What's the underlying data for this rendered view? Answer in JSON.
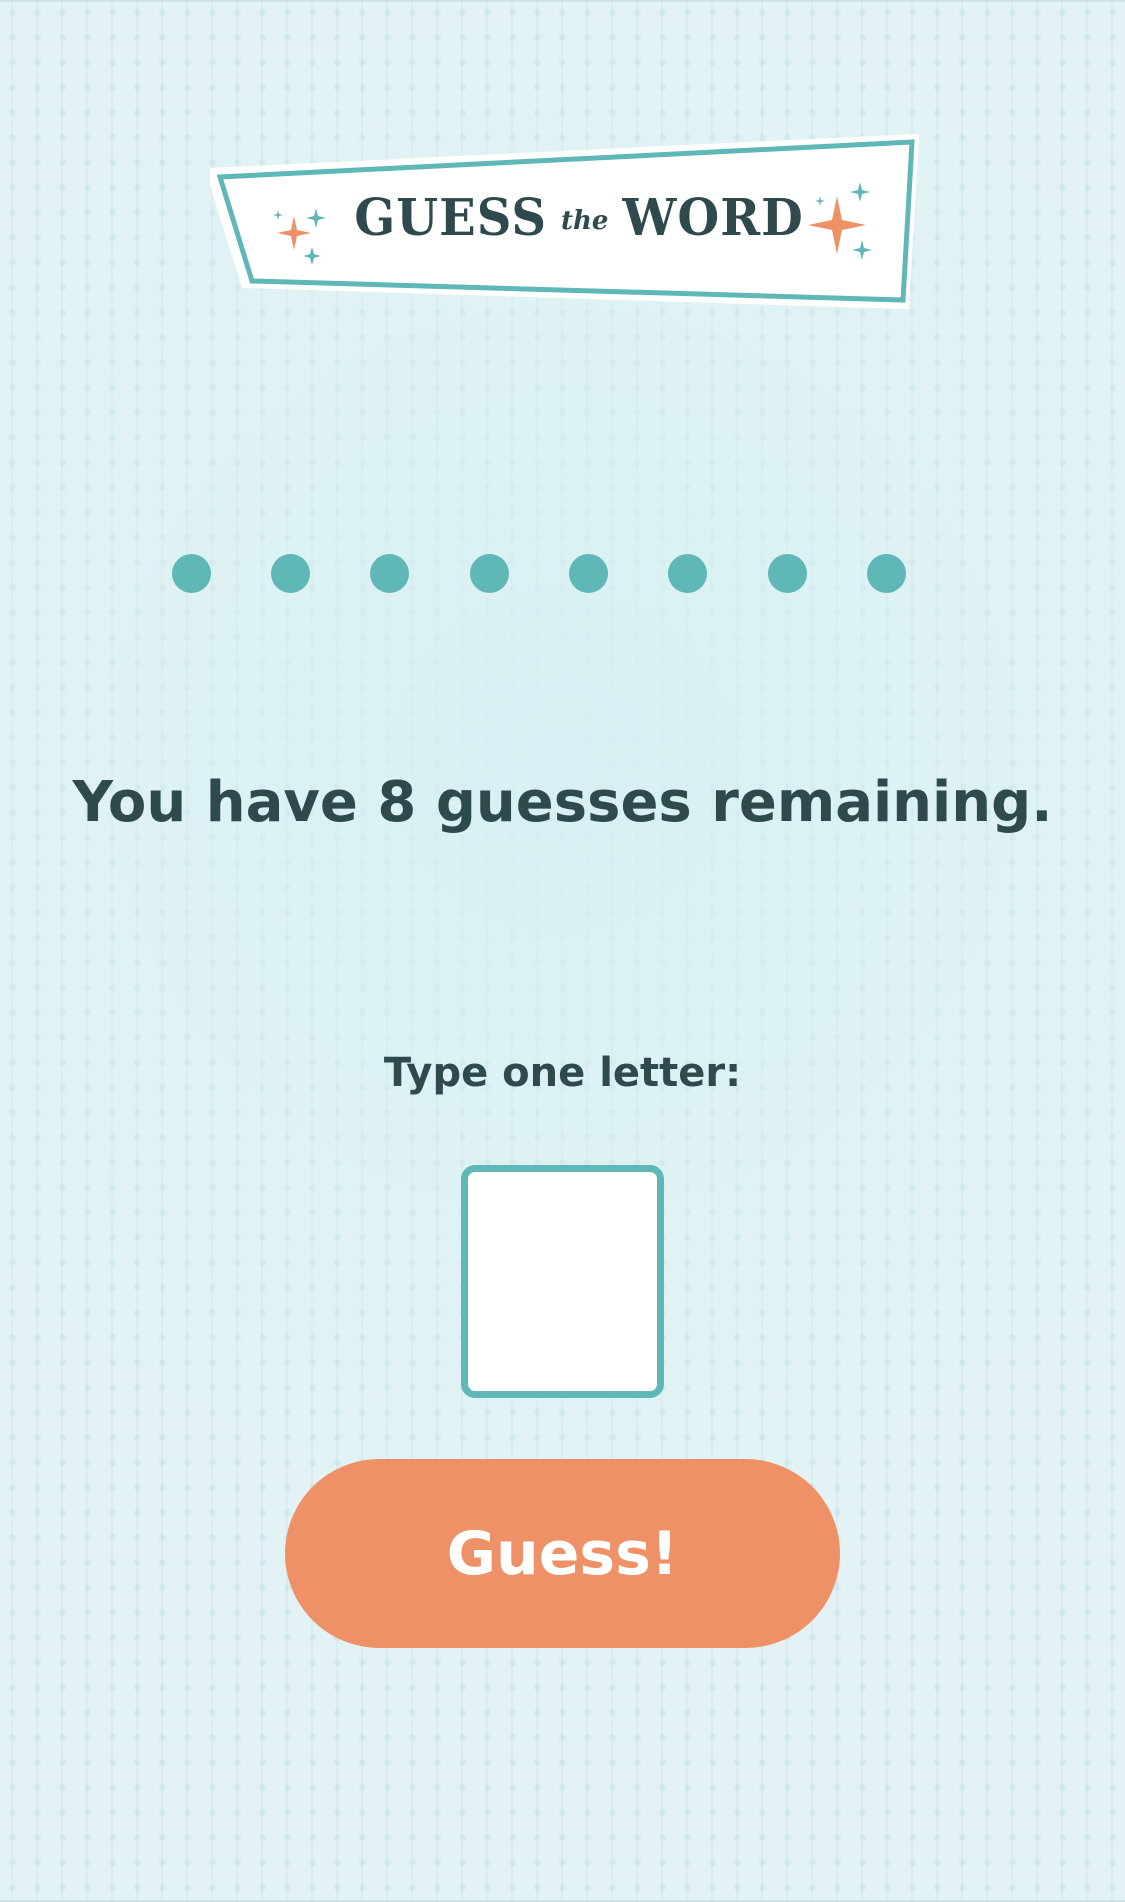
{
  "header": {
    "title_guess": "GUESS",
    "title_the": "the",
    "title_word": "WORD"
  },
  "word_placeholders": 8,
  "status": {
    "remaining_text": "You have 8 guesses remaining.",
    "guesses_remaining": 8
  },
  "input": {
    "label": "Type one letter:",
    "value": "",
    "placeholder": ""
  },
  "button": {
    "label": "Guess!"
  },
  "colors": {
    "background": "#e3f3f5",
    "accent_teal": "#5fb7b7",
    "accent_orange": "#ef9166",
    "text_dark": "#2f4a4c",
    "white": "#ffffff"
  },
  "icons": [
    "sparkle-icon-left",
    "sparkle-icon-right"
  ]
}
